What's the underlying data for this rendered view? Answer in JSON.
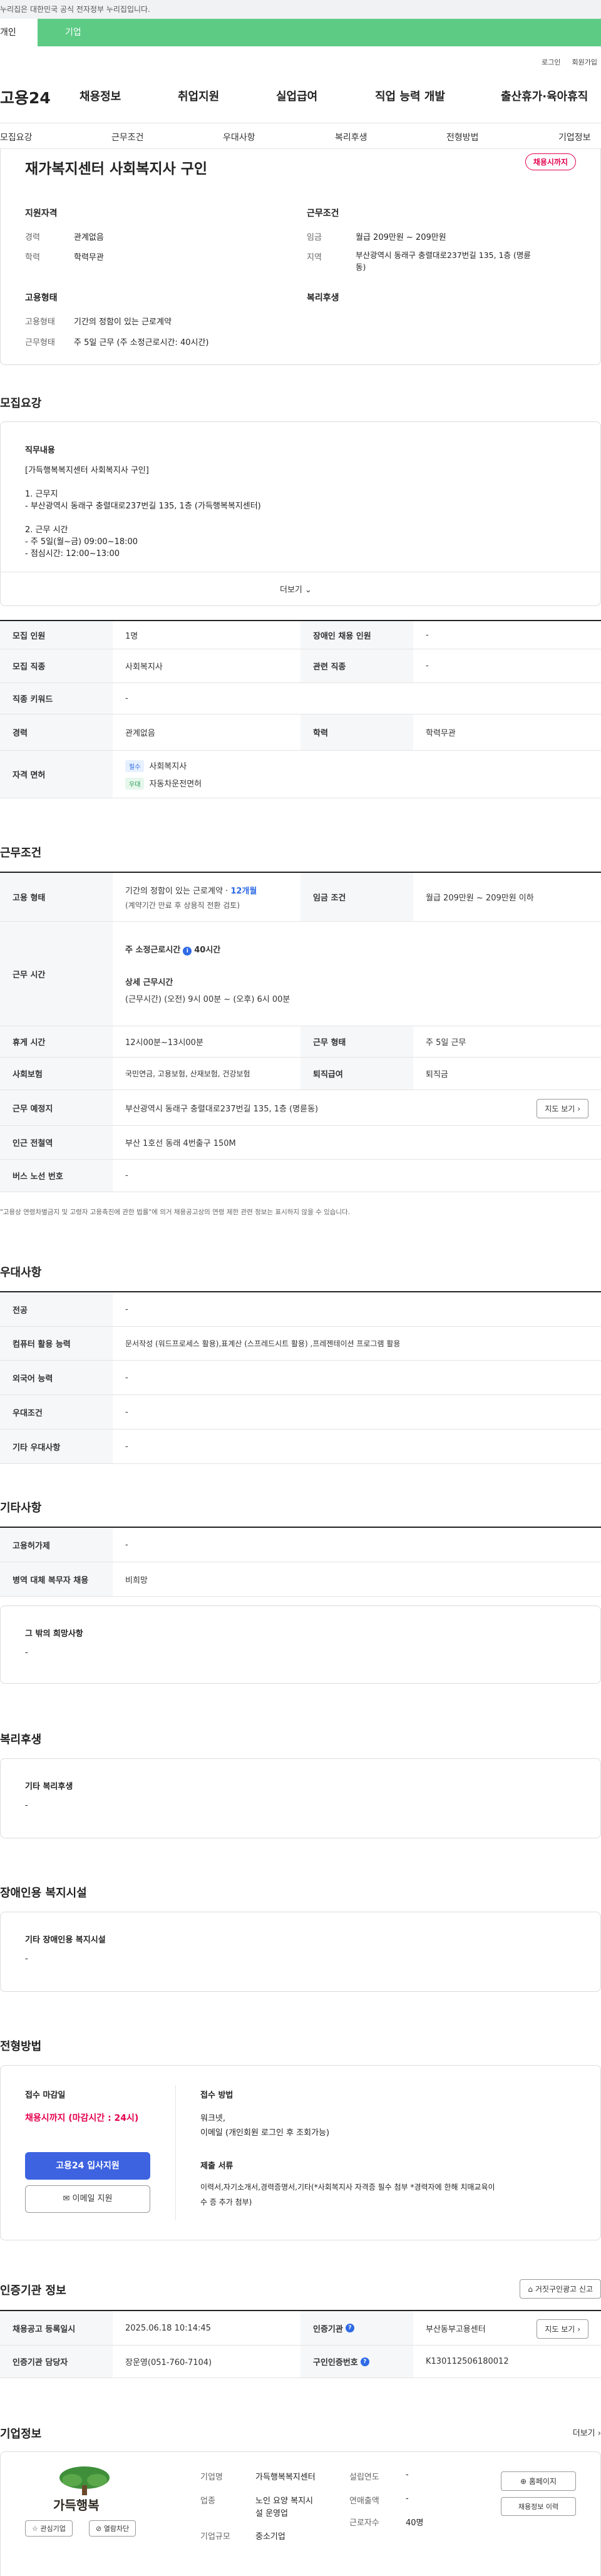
{
  "gov_bar": {
    "text": "누리집은 대한민국 공식 전자정부 누리집입니다."
  },
  "type_tabs": {
    "personal": "개인",
    "company": "기업"
  },
  "util": {
    "login": "로그인",
    "join": "회원가입"
  },
  "gnb": {
    "logo": "고용24",
    "items": [
      "채용정보",
      "취업지원",
      "실업급여",
      "직업 능력 개발",
      "출산휴가·육아휴직"
    ]
  },
  "tabnav": [
    "모집요강",
    "근무조건",
    "우대사항",
    "복리후생",
    "전형방법",
    "기업정보"
  ],
  "header": {
    "title": "재가복지센터 사회복지사 구인",
    "badge": "채용시까지"
  },
  "summary": {
    "qual_title": "지원자격",
    "career_k": "경력",
    "career_v": "관계없음",
    "edu_k": "학력",
    "edu_v": "학력무관",
    "cond_title": "근무조건",
    "wage_k": "임금",
    "wage_v": "월급 209만원 ~ 209만원",
    "region_k": "지역",
    "region_v1": "부산광역시 동래구 충렬대로237번길 135, 1층 (명륜",
    "region_v2": "동)",
    "employ_title": "고용형태",
    "etype_k": "고용형태",
    "etype_v": "기간의 정함이 있는 근로계약",
    "wtype_k": "근무형태",
    "wtype_v": "주 5일 근무 (주 소정근로시간: 40시간)",
    "welfare_title": "복리후생"
  },
  "recruit": {
    "section": "모집요강",
    "job_title": "직무내용",
    "lines": [
      "[가득행복복지센터 사회복지사 구인]",
      "1. 근무지",
      "- 부산광역시 동래구 충렬대로237번길 135, 1층 (가득행복복지센터)",
      "2. 근무 시간",
      "- 주 5일(월~금) 09:00~18:00",
      "- 점심시간: 12:00~13:00"
    ],
    "more": "더보기",
    "rows": {
      "count_k": "모집 인원",
      "count_v": "1명",
      "disabled_k": "장애인 채용 인원",
      "disabled_v": "-",
      "job_k": "모집 직종",
      "job_v": "사회복지사",
      "related_k": "관련 직종",
      "related_v": "-",
      "keyword_k": "직종 키워드",
      "keyword_v": "-",
      "career_k": "경력",
      "career_v": "관계없음",
      "edu_k": "학력",
      "edu_v": "학력무관",
      "license_k": "자격 면허",
      "tag_must": "필수",
      "license1": "사회복지사",
      "tag_pref": "우대",
      "license2": "자동차운전면허"
    }
  },
  "work": {
    "section": "근무조건",
    "etype_k": "고용 형태",
    "etype_v1": "기간의 정함이 있는 근로계약 · ",
    "etype_months": "12개월",
    "etype_v2": "(계약기간 만료 후 상용직 전환 검토)",
    "wage_k": "임금 조건",
    "wage_v": "월급 209만원 ~ 209만원 이하",
    "hours_k": "근무 시간",
    "hours_h1": "주 소정근로시간",
    "hours_badge": "i",
    "hours_h1v": "40시간",
    "hours_h2": "상세 근무시간",
    "hours_v": "(근무시간) (오전) 9시 00분 ~ (오후) 6시 00분",
    "break_k": "휴게 시간",
    "break_v": "12시00분~13시00분",
    "wform_k": "근무 형태",
    "wform_v": "주 5일 근무",
    "insure_k": "사회보험",
    "insure_v": "국민연금, 고용보험, 산재보험, 건강보험",
    "retire_k": "퇴직급여",
    "retire_v": "퇴직금",
    "place_k": "근무 예정지",
    "place_v": "부산광역시 동래구 충렬대로237번길 135, 1층 (명륜동)",
    "map_btn": "지도 보기",
    "subway_k": "인근 전철역",
    "subway_v": "부산 1호선 동래 4번출구 150M",
    "bus_k": "버스 노선 번호",
    "bus_v": "-",
    "note": "\"고용상 연령차별금지 및 고령자 고용촉진에 관한 법률\"에 의거 채용공고상의 연령 제한 관련 정보는 표시하지 않을 수 있습니다."
  },
  "pref": {
    "section": "우대사항",
    "major_k": "전공",
    "major_v": "-",
    "pc_k": "컴퓨터 활용 능력",
    "pc_v": "문서작성 (워드프로세스 활용),표계산 (스프레드시트 활용) ,프레젠테이션 프로그램 활용",
    "lang_k": "외국어 능력",
    "lang_v": "-",
    "cond_k": "우대조건",
    "cond_v": "-",
    "etc_k": "기타 우대사항",
    "etc_v": "-"
  },
  "etc": {
    "section": "기타사항",
    "insure_k": "고용허가제",
    "insure_v": "-",
    "mil_k": "병역 대체 복무자 채용",
    "mil_v": "비희망",
    "other_title": "그 밖의 희망사항",
    "other_v": "-"
  },
  "welfare": {
    "section": "복리후생",
    "title": "기타 복리후생",
    "v": "-"
  },
  "disab": {
    "section": "장애인용 복지시설",
    "title": "기타 장애인용 복지시설",
    "v": "-"
  },
  "process": {
    "section": "전형방법",
    "deadline_title": "접수 마감일",
    "deadline_v": "채용시까지 (마감시간 : 24시)",
    "apply_btn": "고용24 입사지원",
    "email_btn": "이메일 지원",
    "method_title": "접수 방법",
    "method_v1": "워크넷,",
    "method_v2": "이메일 (개인회원 로그인 후 조회가능)",
    "docs_title": "제출 서류",
    "docs_v1": "이력서,자기소개서,경력증명서,기타(*사회복지사 자격증 필수 첨부 *경력자에 한해 치매교육이",
    "docs_v2": "수 증 추가 첨부)"
  },
  "cert": {
    "section": "인증기관 정보",
    "report_btn": "거짓구인광고 신고",
    "reg_k": "채용공고 등록일시",
    "reg_v": "2025.06.18 10:14:45",
    "org_k": "인증기관",
    "org_v": "부산동부고용센터",
    "map_btn": "지도 보기",
    "mgr_k": "인증기관 담당자",
    "mgr_v": "장운영(051-760-7104)",
    "num_k": "구인인증번호",
    "num_v": "K130112506180012"
  },
  "company": {
    "section": "기업정보",
    "more": "더보기",
    "logo_text": "가득행복",
    "fav_btn": "관심기업",
    "block_btn": "열람차단",
    "name_k": "기업명",
    "name_v": "가득행복복지센터",
    "biz_k": "업종",
    "biz_v1": "노인 요양 복지시",
    "biz_v2": "설 운영업",
    "size_k": "기업규모",
    "size_v": "중소기업",
    "est_k": "설립연도",
    "est_v": "-",
    "sales_k": "연매출액",
    "sales_v": "-",
    "emp_k": "근로자수",
    "emp_v": "40명",
    "home_btn": "홈페이지",
    "jobs_btn": "채용정보 이력"
  }
}
